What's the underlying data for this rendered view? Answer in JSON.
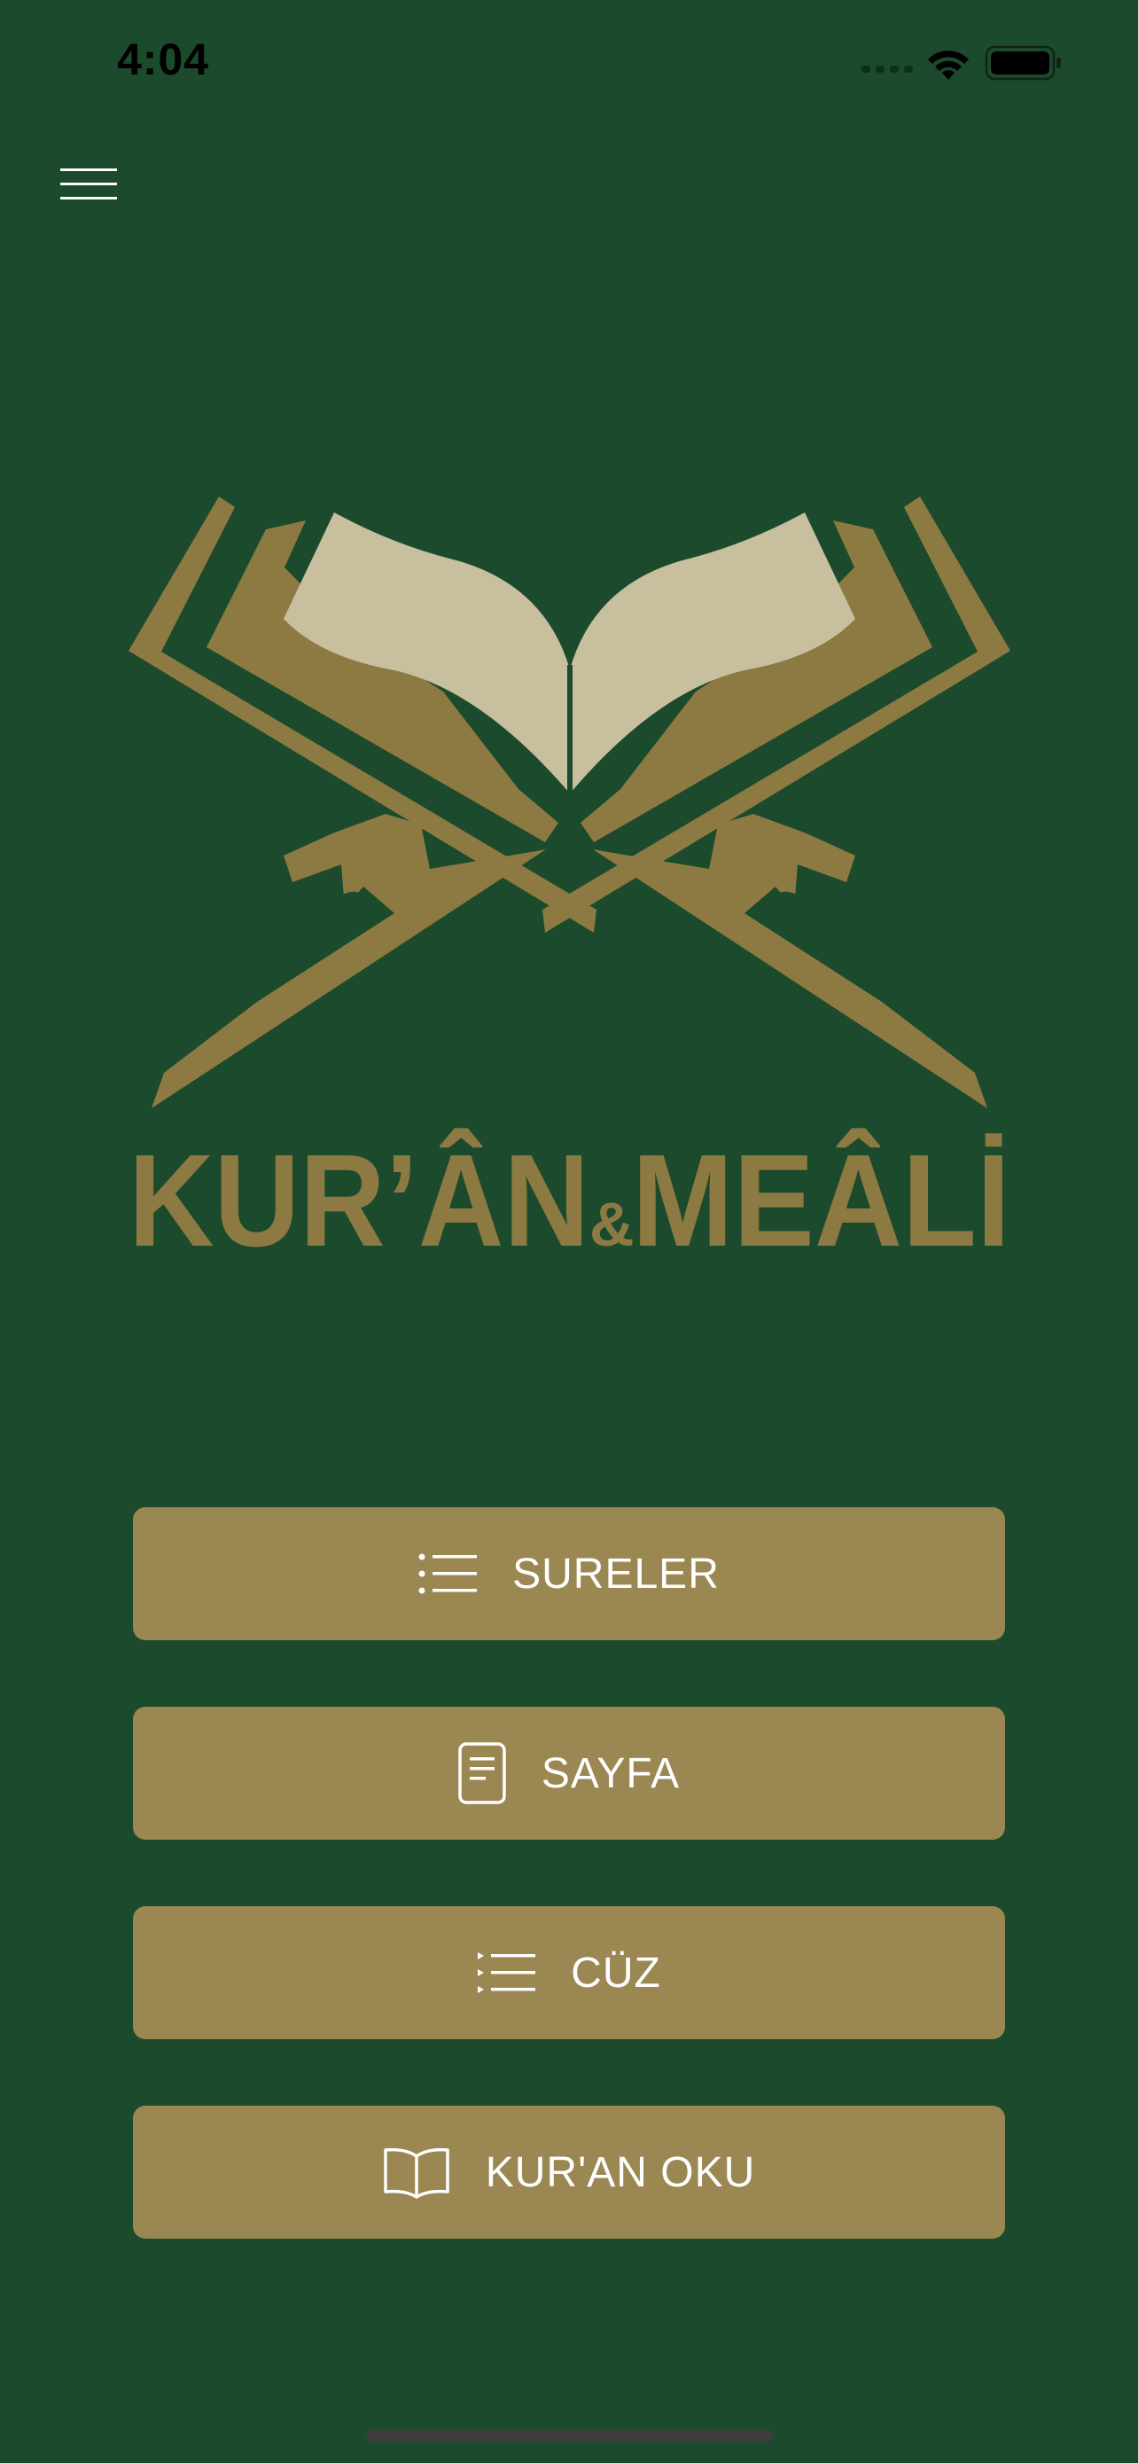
{
  "status_bar": {
    "time": "4:04"
  },
  "header": {
    "menu_icon": "hamburger-icon"
  },
  "logo": {
    "text_main": "KUR’ÂN",
    "text_amp": "&",
    "text_tail": "MEÂLİ"
  },
  "menu": {
    "buttons": [
      {
        "label": "SURELER",
        "icon": "list-icon"
      },
      {
        "label": "SAYFA",
        "icon": "page-icon"
      },
      {
        "label": "CÜZ",
        "icon": "list-play-icon"
      },
      {
        "label": "KUR'AN OKU",
        "icon": "book-open-icon"
      }
    ]
  },
  "colors": {
    "background": "#1c4a2c",
    "button": "#9a8752",
    "logo_gold": "#8c7a42",
    "logo_page": "#c8bf9e",
    "text": "#ffffff"
  }
}
